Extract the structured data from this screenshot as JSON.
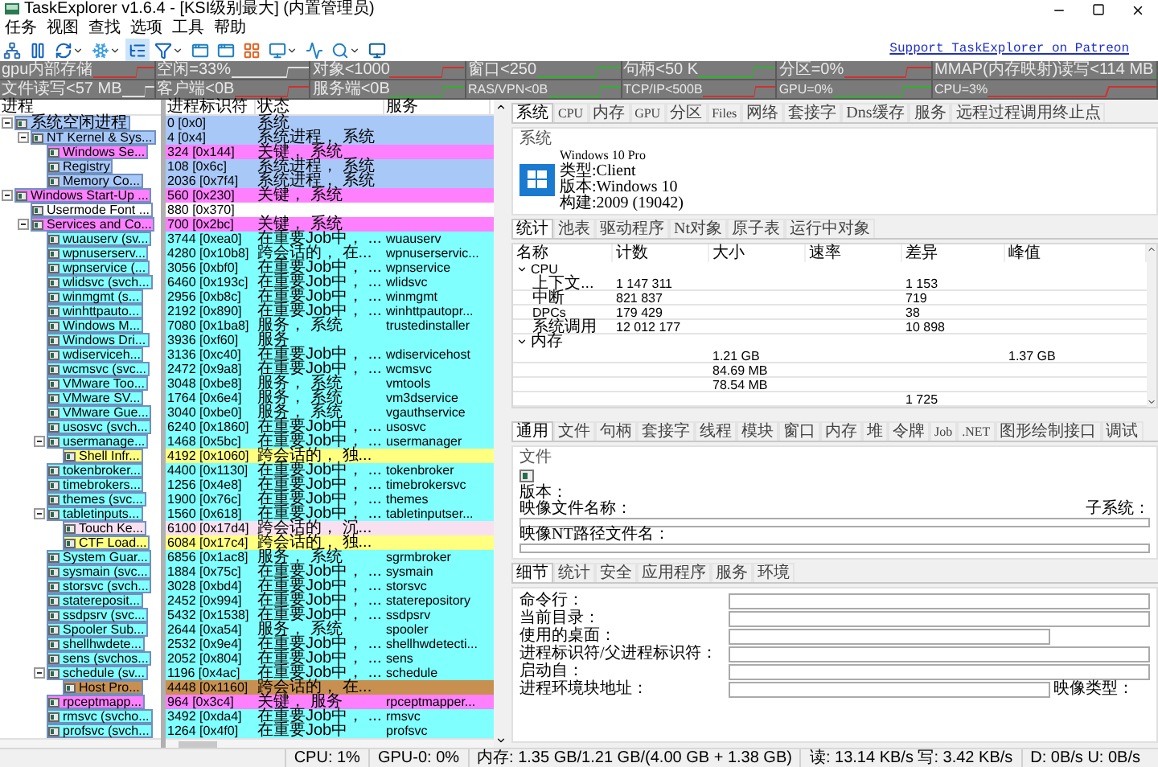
{
  "window": {
    "title": "TaskExplorer v1.6.4 - [KSI级别最大] (内置管理员)"
  },
  "menu": [
    "任务",
    "视图",
    "查找",
    "选项",
    "工具",
    "帮助"
  ],
  "toolbar": {
    "link": "Support TaskExplorer on Patreon"
  },
  "graphs": [
    [
      "gpu内部存储",
      "空闲=33%",
      "对象<1000",
      "窗口<250",
      "句柄<50 K",
      "分区=0%",
      "MMAP(内存映射)读写<114 MB"
    ],
    [
      "文件读写<57 MB",
      "客户端<0B",
      "服务端<0B",
      "RAS/VPN<0B",
      "TCP/IP<500B",
      "GPU=0%",
      "CPU=3%"
    ]
  ],
  "process_tree": {
    "column": "进程"
  },
  "process_table": {
    "columns": [
      "进程标识符",
      "状态",
      "服务"
    ]
  },
  "processes": [
    {
      "name": "系统空闲进程",
      "pid": "0 [0x0]",
      "status": "系统",
      "color": "#a8c8f8",
      "children": [
        {
          "name": "NT Kernel & Sys...",
          "pid": "4 [0x4]",
          "status": "系统进程， 系统",
          "color": "#a8c8f8",
          "children": [
            {
              "name": "Windows Se...",
              "pid": "324 [0x144]",
              "status": "关键， 系统",
              "color": "#ff80ff"
            },
            {
              "name": "Registry",
              "pid": "108 [0x6c]",
              "status": "系统进程， 系统",
              "color": "#a8c8f8"
            },
            {
              "name": "Memory Co...",
              "pid": "2036 [0x7f4]",
              "status": "系统进程， 系统",
              "color": "#a8c8f8"
            }
          ]
        }
      ]
    },
    {
      "name": "Windows Start-Up ...",
      "pid": "560 [0x230]",
      "status": "关键， 系统",
      "color": "#ff80ff",
      "children": [
        {
          "name": "Usermode Font ...",
          "pid": "880 [0x370]",
          "color": "#ffffff"
        },
        {
          "name": "Services and Co...",
          "pid": "700 [0x2bc]",
          "status": "关键， 系统",
          "color": "#ff80ff",
          "children": [
            {
              "name": "wuauserv (sv...",
              "pid": "3744 [0xea0]",
              "status": "在重要Job中， ...",
              "service": "wuauserv",
              "color": "#80ffff"
            },
            {
              "name": "wpnuserserv...",
              "pid": "4280 [0x10b8]",
              "status": "跨会话的， 在...",
              "service": "wpnuserservic...",
              "color": "#80ffff"
            },
            {
              "name": "wpnservice (...",
              "pid": "3056 [0xbf0]",
              "status": "在重要Job中， ...",
              "service": "wpnservice",
              "color": "#80ffff"
            },
            {
              "name": "wlidsvc (svch...",
              "pid": "6460 [0x193c]",
              "status": "在重要Job中， ...",
              "service": "wlidsvc",
              "color": "#80ffff"
            },
            {
              "name": "winmgmt (s...",
              "pid": "2956 [0xb8c]",
              "status": "在重要Job中， ...",
              "service": "winmgmt",
              "color": "#80ffff"
            },
            {
              "name": "winhttpauto...",
              "pid": "2192 [0x890]",
              "status": "在重要Job中， ...",
              "service": "winhttpautopr...",
              "color": "#80ffff"
            },
            {
              "name": "Windows M...",
              "pid": "7080 [0x1ba8]",
              "status": "服务， 系统",
              "service": "trustedinstaller",
              "color": "#80ffff"
            },
            {
              "name": "Windows Dri...",
              "pid": "3936 [0xf60]",
              "status": "服务",
              "color": "#80ffff"
            },
            {
              "name": "wdiserviceh...",
              "pid": "3136 [0xc40]",
              "status": "在重要Job中， ...",
              "service": "wdiservicehost",
              "color": "#80ffff"
            },
            {
              "name": "wcmsvc (svc...",
              "pid": "2472 [0x9a8]",
              "status": "在重要Job中， ...",
              "service": "wcmsvc",
              "color": "#80ffff"
            },
            {
              "name": "VMware Too...",
              "pid": "3048 [0xbe8]",
              "status": "服务， 系统",
              "service": "vmtools",
              "color": "#80ffff"
            },
            {
              "name": "VMware SV...",
              "pid": "1764 [0x6e4]",
              "status": "服务， 系统",
              "service": "vm3dservice",
              "color": "#80ffff"
            },
            {
              "name": "VMware Gue...",
              "pid": "3040 [0xbe0]",
              "status": "服务， 系统",
              "service": "vgauthservice",
              "color": "#80ffff"
            },
            {
              "name": "usosvc (svch...",
              "pid": "6240 [0x1860]",
              "status": "在重要Job中， ...",
              "service": "usosvc",
              "color": "#80ffff"
            },
            {
              "name": "usermanage...",
              "pid": "1468 [0x5bc]",
              "status": "在重要Job中， ...",
              "service": "usermanager",
              "color": "#80ffff",
              "children": [
                {
                  "name": "Shell Infr...",
                  "pid": "4192 [0x1060]",
                  "status": "跨会话的， 独...",
                  "color": "#ffff80"
                }
              ]
            },
            {
              "name": "tokenbroker...",
              "pid": "4400 [0x1130]",
              "status": "在重要Job中， ...",
              "service": "tokenbroker",
              "color": "#80ffff"
            },
            {
              "name": "timebrokers...",
              "pid": "1256 [0x4e8]",
              "status": "在重要Job中， ...",
              "service": "timebrokersvc",
              "color": "#80ffff"
            },
            {
              "name": "themes (svc...",
              "pid": "1900 [0x76c]",
              "status": "在重要Job中， ...",
              "service": "themes",
              "color": "#80ffff"
            },
            {
              "name": "tabletinputs...",
              "pid": "1560 [0x618]",
              "status": "在重要Job中， ...",
              "service": "tabletinputser...",
              "color": "#80ffff",
              "children": [
                {
                  "name": "Touch Ke...",
                  "pid": "6100 [0x17d4]",
                  "status": "跨会话的， 沉...",
                  "color": "#f8e0f0"
                },
                {
                  "name": "CTF Load...",
                  "pid": "6084 [0x17c4]",
                  "status": "跨会话的， 独...",
                  "color": "#ffff80"
                }
              ]
            },
            {
              "name": "System Guar...",
              "pid": "6856 [0x1ac8]",
              "status": "服务， 系统",
              "service": "sgrmbroker",
              "color": "#80ffff"
            },
            {
              "name": "sysmain (svc...",
              "pid": "1884 [0x75c]",
              "status": "在重要Job中， ...",
              "service": "sysmain",
              "color": "#80ffff"
            },
            {
              "name": "storsvc (svch...",
              "pid": "3028 [0xbd4]",
              "status": "在重要Job中， ...",
              "service": "storsvc",
              "color": "#80ffff"
            },
            {
              "name": "statereposit...",
              "pid": "2452 [0x994]",
              "status": "在重要Job中， ...",
              "service": "staterepository",
              "color": "#80ffff"
            },
            {
              "name": "ssdpsrv (svc...",
              "pid": "5432 [0x1538]",
              "status": "在重要Job中， ...",
              "service": "ssdpsrv",
              "color": "#80ffff"
            },
            {
              "name": "Spooler Sub...",
              "pid": "2644 [0xa54]",
              "status": "服务， 系统",
              "service": "spooler",
              "color": "#80ffff"
            },
            {
              "name": "shellhwdete...",
              "pid": "2532 [0x9e4]",
              "status": "在重要Job中， ...",
              "service": "shellhwdetecti...",
              "color": "#80ffff"
            },
            {
              "name": "sens (svchos...",
              "pid": "2052 [0x804]",
              "status": "在重要Job中， ...",
              "service": "sens",
              "color": "#80ffff"
            },
            {
              "name": "schedule (sv...",
              "pid": "1196 [0x4ac]",
              "status": "在重要Job中， ...",
              "service": "schedule",
              "color": "#80ffff",
              "children": [
                {
                  "name": "Host Pro...",
                  "pid": "4448 [0x1160]",
                  "status": "跨会话的， 在...",
                  "color": "#c89050"
                }
              ]
            },
            {
              "name": "rpceptmapp...",
              "pid": "964 [0x3c4]",
              "status": "关键， 服务",
              "service": "rpceptmapper...",
              "color": "#ff80ff"
            },
            {
              "name": "rmsvc (svcho...",
              "pid": "3492 [0xda4]",
              "status": "在重要Job中， ...",
              "service": "rmsvc",
              "color": "#80ffff"
            },
            {
              "name": "profsvc (svch...",
              "pid": "1264 [0x4f0]",
              "status": "在重要Job中",
              "service": "profsvc",
              "color": "#80ffff"
            }
          ]
        }
      ]
    }
  ],
  "system_tabs": [
    {
      "label": "系统",
      "selected": true
    },
    {
      "label": "CPU",
      "selected": false
    },
    {
      "label": "内存",
      "selected": false
    },
    {
      "label": "GPU",
      "selected": false
    },
    {
      "label": "分区",
      "selected": false
    },
    {
      "label": "Files",
      "selected": false
    },
    {
      "label": "网络",
      "selected": false
    },
    {
      "label": "套接字",
      "selected": false
    },
    {
      "label": "Dns缓存",
      "selected": false
    },
    {
      "label": "服务",
      "selected": false
    },
    {
      "label": "远程过程调用终止点",
      "selected": false
    }
  ],
  "system": {
    "title": "系统",
    "lines": [
      "Windows 10 Pro",
      "类型:Client",
      "版本:Windows 10",
      "构建:2009 (19042)"
    ]
  },
  "stats_tabs": [
    {
      "label": "统计",
      "selected": true
    },
    {
      "label": "池表",
      "selected": false
    },
    {
      "label": "驱动程序",
      "selected": false
    },
    {
      "label": "Nt对象",
      "selected": false
    },
    {
      "label": "原子表",
      "selected": false
    },
    {
      "label": "运行中对象",
      "selected": false
    }
  ],
  "stats": {
    "columns": [
      "名称",
      "计数",
      "大小",
      "速率",
      "差异",
      "峰值"
    ],
    "rows": [
      {
        "name": "CPU",
        "children": [
          {
            "name": "上下文...",
            "count": "1 147 311",
            "diff": "1 153"
          },
          {
            "name": "中断",
            "count": "821 837",
            "diff": "719"
          },
          {
            "name": "DPCs",
            "count": "179 429",
            "diff": "38"
          },
          {
            "name": "系统调用",
            "count": "12 012 177",
            "diff": "10 898"
          }
        ]
      },
      {
        "name": "内存",
        "children": [
          {
            "size": "1.21 GB",
            "peak": "1.37 GB"
          },
          {
            "size": "84.69 MB"
          },
          {
            "size": "78.54 MB"
          },
          {
            "diff": "1 725"
          }
        ]
      }
    ]
  },
  "process_tabs": [
    {
      "label": "通用",
      "selected": true
    },
    {
      "label": "文件",
      "selected": false
    },
    {
      "label": "句柄",
      "selected": false
    },
    {
      "label": "套接字",
      "selected": false
    },
    {
      "label": "线程",
      "selected": false
    },
    {
      "label": "模块",
      "selected": false
    },
    {
      "label": "窗口",
      "selected": false
    },
    {
      "label": "内存",
      "selected": false
    },
    {
      "label": "堆",
      "selected": false
    },
    {
      "label": "令牌",
      "selected": false
    },
    {
      "label": "Job",
      "selected": false
    },
    {
      "label": ".NET",
      "selected": false
    },
    {
      "label": "图形绘制接口",
      "selected": false
    },
    {
      "label": "调试",
      "selected": false
    }
  ],
  "file": {
    "title": "文件",
    "version": "版本：",
    "image_name": "映像文件名称：",
    "subsystem": "子系统：",
    "nt_path": "映像NT路径文件名："
  },
  "detail_tabs": [
    {
      "label": "细节",
      "selected": true
    },
    {
      "label": "统计",
      "selected": false
    },
    {
      "label": "安全",
      "selected": false
    },
    {
      "label": "应用程序",
      "selected": false
    },
    {
      "label": "服务",
      "selected": false
    },
    {
      "label": "环境",
      "selected": false
    }
  ],
  "details": [
    {
      "label": "命令行：",
      "kind": "full"
    },
    {
      "label": "当前目录：",
      "kind": "full"
    },
    {
      "label": "使用的桌面：",
      "kind": "short"
    },
    {
      "label": "进程标识符/父进程标识符：",
      "kind": "full"
    },
    {
      "label": "启动自：",
      "kind": "full"
    },
    {
      "label": "进程环境块地址：",
      "kind": "short",
      "after": "映像类型："
    }
  ],
  "status_bar": [
    "CPU: 1%",
    "GPU-0: 0%",
    "内存: 1.35 GB/1.21 GB/(4.00 GB + 1.38 GB)",
    "读: 13.14 KB/s 写: 3.42 KB/s",
    "D: 0B/s U: 0B/s"
  ]
}
